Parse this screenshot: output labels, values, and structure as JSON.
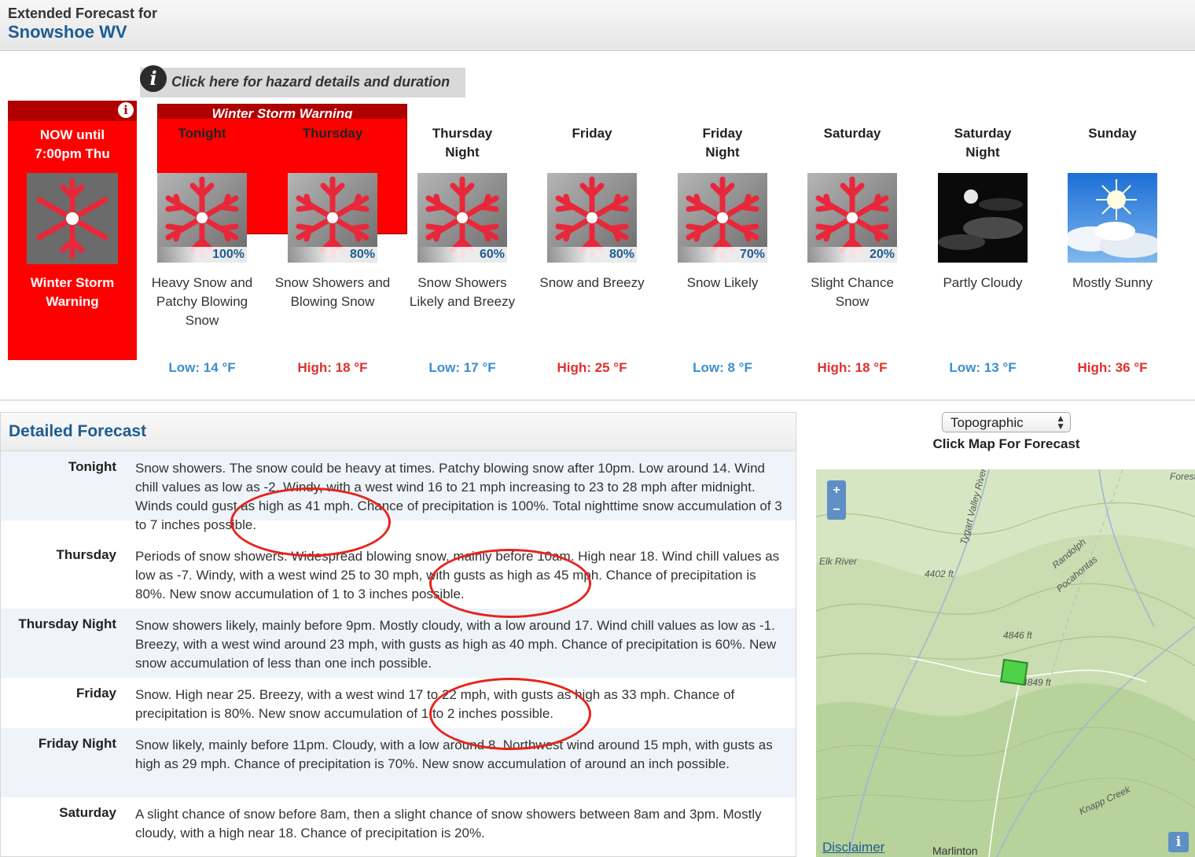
{
  "header": {
    "label": "Extended Forecast for",
    "location": "Snowshoe WV"
  },
  "hazard": {
    "link_text": "Click here for hazard details and duration",
    "banner": "Winter Storm Warning"
  },
  "now_box": {
    "line1": "NOW until",
    "line2": "7:00pm Thu",
    "label1": "Winter Storm",
    "label2": "Warning"
  },
  "periods": [
    {
      "name1": "Tonight",
      "name2": "",
      "text": "Heavy Snow and Patchy Blowing Snow",
      "temp": "Low: 14 °F",
      "pct": "100%",
      "icon": "snow-icon"
    },
    {
      "name1": "Thursday",
      "name2": "",
      "text": "Snow Showers and Blowing Snow",
      "temp": "High: 18 °F",
      "pct": "80%",
      "icon": "snow-icon"
    },
    {
      "name1": "Thursday",
      "name2": "Night",
      "text": "Snow Showers Likely and Breezy",
      "temp": "Low: 17 °F",
      "pct": "60%",
      "icon": "snow-icon"
    },
    {
      "name1": "Friday",
      "name2": "",
      "text": "Snow and Breezy",
      "temp": "High: 25 °F",
      "pct": "80%",
      "icon": "snow-icon"
    },
    {
      "name1": "Friday",
      "name2": "Night",
      "text": "Snow Likely",
      "temp": "Low: 8 °F",
      "pct": "70%",
      "icon": "snow-icon"
    },
    {
      "name1": "Saturday",
      "name2": "",
      "text": "Slight Chance Snow",
      "temp": "High: 18 °F",
      "pct": "20%",
      "icon": "snow-icon"
    },
    {
      "name1": "Saturday",
      "name2": "Night",
      "text": "Partly Cloudy",
      "temp": "Low: 13 °F",
      "pct": "",
      "icon": "partly-cloudy-night-icon"
    },
    {
      "name1": "Sunday",
      "name2": "",
      "text": "Mostly Sunny",
      "temp": "High: 36 °F",
      "pct": "",
      "icon": "mostly-sunny-icon"
    }
  ],
  "detailed": {
    "title": "Detailed Forecast",
    "rows": [
      {
        "label": "Tonight",
        "text": "Snow showers. The snow could be heavy at times. Patchy blowing snow after 10pm. Low around 14. Wind chill values as low as -2. Windy, with a west wind 16 to 21 mph increasing to 23 to 28 mph after midnight. Winds could gust as high as 41 mph. Chance of precipitation is 100%. Total nighttime snow accumulation of 3 to 7 inches possible."
      },
      {
        "label": "Thursday",
        "text": "Periods of snow showers. Widespread blowing snow, mainly before 10am. High near 18. Wind chill values as low as -7. Windy, with a west wind 25 to 30 mph, with gusts as high as 45 mph. Chance of precipitation is 80%. New snow accumulation of 1 to 3 inches possible."
      },
      {
        "label": "Thursday Night",
        "text": "Snow showers likely, mainly before 9pm. Mostly cloudy, with a low around 17. Wind chill values as low as -1. Breezy, with a west wind around 23 mph, with gusts as high as 40 mph. Chance of precipitation is 60%. New snow accumulation of less than one inch possible."
      },
      {
        "label": "Friday",
        "text": "Snow. High near 25. Breezy, with a west wind 17 to 22 mph, with gusts as high as 33 mph. Chance of precipitation is 80%. New snow accumulation of 1 to 2 inches possible."
      },
      {
        "label": "Friday Night",
        "text": "Snow likely, mainly before 11pm. Cloudy, with a low around 8. Northwest wind around 15 mph, with gusts as high as 29 mph. Chance of precipitation is 70%. New snow accumulation of around an inch possible."
      },
      {
        "label": "Saturday",
        "text": "A slight chance of snow before 8am, then a slight chance of snow showers between 8am and 3pm. Mostly cloudy, with a high near 18. Chance of precipitation is 20%."
      }
    ]
  },
  "map": {
    "select_value": "Topographic",
    "caption": "Click Map For Forecast",
    "zoom_in": "+",
    "zoom_out": "−",
    "labels": [
      "4402 ft",
      "4846 ft",
      "4849 ft",
      "Randolph",
      "Pocahontas",
      "Knapp Creek",
      "Forest",
      "Tygart Valley River",
      "Elk River"
    ],
    "disclaimer": "Disclaimer",
    "town": "Marlinton",
    "info": "i"
  }
}
